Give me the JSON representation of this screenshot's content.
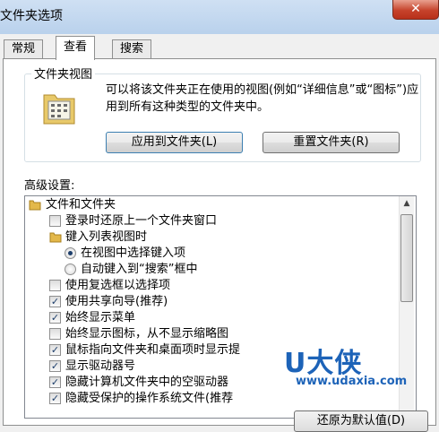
{
  "window": {
    "title": "文件夹选项",
    "close_glyph": "✕"
  },
  "tabs": [
    {
      "label": "常规",
      "active": false
    },
    {
      "label": "查看",
      "active": true
    },
    {
      "label": "搜索",
      "active": false
    }
  ],
  "folder_view": {
    "title": "文件夹视图",
    "icon": "folder-view-icon",
    "description": "可以将该文件夹正在使用的视图(例如“详细信息”或“图标”)应用到所有这种类型的文件夹中。",
    "apply_button": "应用到文件夹(L)",
    "reset_button": "重置文件夹(R)"
  },
  "advanced": {
    "label": "高级设置:",
    "items": [
      {
        "type": "folder",
        "label": "文件和文件夹"
      },
      {
        "type": "checkbox",
        "label": "登录时还原上一个文件夹窗口",
        "checked": false
      },
      {
        "type": "folder",
        "label": "键入列表视图时"
      },
      {
        "type": "radio",
        "label": "在视图中选择键入项",
        "checked": true
      },
      {
        "type": "radio",
        "label": "自动键入到“搜索”框中",
        "checked": false
      },
      {
        "type": "checkbox",
        "label": "使用复选框以选择项",
        "checked": false
      },
      {
        "type": "checkbox",
        "label": "使用共享向导(推荐)",
        "checked": true
      },
      {
        "type": "checkbox",
        "label": "始终显示菜单",
        "checked": true
      },
      {
        "type": "checkbox",
        "label": "始终显示图标，从不显示缩略图",
        "checked": false
      },
      {
        "type": "checkbox",
        "label": "鼠标指向文件夹和桌面项时显示提",
        "checked": true
      },
      {
        "type": "checkbox",
        "label": "显示驱动器号",
        "checked": true
      },
      {
        "type": "checkbox",
        "label": "隐藏计算机文件夹中的空驱动器",
        "checked": true
      },
      {
        "type": "checkbox",
        "label": "隐藏受保护的操作系统文件(推荐",
        "checked": true
      }
    ]
  },
  "bottom_button": "还原为默认值(D)",
  "watermark": {
    "logo": "U大侠",
    "url": "www.udaxia.com"
  },
  "colors": {
    "watermark": "#1d63b8",
    "titlebar": "#b9d1ec",
    "close": "#c6432c"
  }
}
